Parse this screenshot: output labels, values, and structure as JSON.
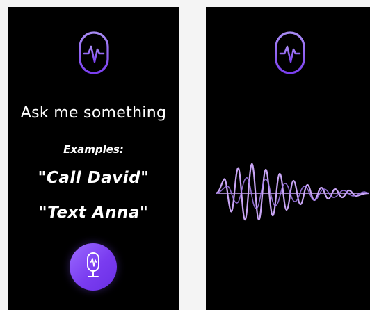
{
  "screens": {
    "left": {
      "prompt_title": "Ask me something",
      "examples_label": "Examples:",
      "examples": [
        "\"Call David\"",
        "\"Text Anna\""
      ],
      "mic_button_icon": "microphone-icon"
    },
    "right": {
      "header_icon": "microphone-icon",
      "waveform_icon": "sound-waveform"
    }
  },
  "colors": {
    "screen_bg": "#000000",
    "accent_light": "#c9a6f5",
    "accent": "#8a4cf2",
    "accent_dark": "#6a2fe6",
    "text": "#ffffff"
  }
}
